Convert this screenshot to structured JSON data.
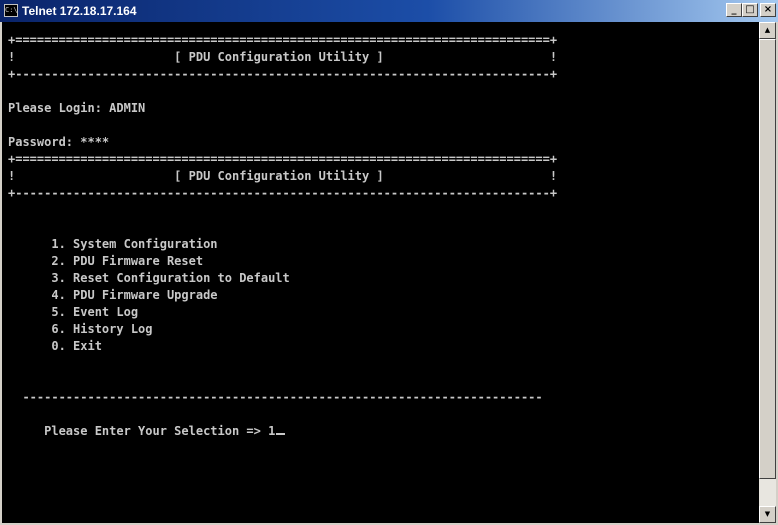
{
  "window": {
    "title": "Telnet 172.18.17.164",
    "icon": "console-icon",
    "icon_glyph": "C:\\",
    "controls": {
      "minimize": "_",
      "maximize": "□",
      "close": "×"
    }
  },
  "terminal": {
    "lines": [
      "+==========================================================================+",
      "!                      [ PDU Configuration Utility ]                       !",
      "+--------------------------------------------------------------------------+",
      "",
      "Please Login: ADMIN",
      "",
      "Password: ****",
      "+==========================================================================+",
      "!                      [ PDU Configuration Utility ]                       !",
      "+--------------------------------------------------------------------------+",
      "",
      "",
      "      1. System Configuration",
      "      2. PDU Firmware Reset",
      "      3. Reset Configuration to Default",
      "      4. PDU Firmware Upgrade",
      "      5. Event Log",
      "      6. History Log",
      "      0. Exit",
      "",
      "",
      "  ------------------------------------------------------------------------",
      "",
      "     Please Enter Your Selection => 1"
    ],
    "text_color": "#c8c8c8",
    "background_color": "#000000"
  },
  "scrollbar": {
    "up_arrow": "▲",
    "down_arrow": "▼"
  }
}
